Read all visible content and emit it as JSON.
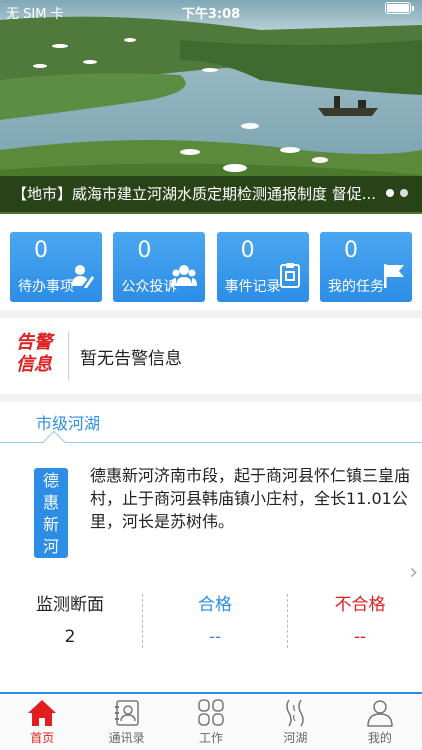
{
  "status_bar": {
    "carrier": "无 SIM 卡",
    "time": "下午3:08"
  },
  "banner": {
    "caption": "【地市】威海市建立河湖水质定期检测通报制度 督促..."
  },
  "cards": [
    {
      "count": "0",
      "label": "待办事项",
      "icon": "edit-user-icon"
    },
    {
      "count": "0",
      "label": "公众投诉",
      "icon": "group-icon"
    },
    {
      "count": "0",
      "label": "事件记录",
      "icon": "clipboard-icon"
    },
    {
      "count": "0",
      "label": "我的任务",
      "icon": "flag-icon"
    }
  ],
  "alert": {
    "logo_line1": "告警",
    "logo_line2": "信息",
    "text": "暂无告警信息"
  },
  "river": {
    "tab": "市级河湖",
    "name_chars": [
      "德",
      "惠",
      "新",
      "河"
    ],
    "description": "德惠新河济南市段，起于商河县怀仁镇三皇庙村，止于商河县韩庙镇小庄村，全长11.01公里，河长是苏树伟。",
    "stats": [
      {
        "label": "监测断面",
        "value": "2",
        "color": "#222222"
      },
      {
        "label": "合格",
        "value": "--",
        "color": "#2d8de6"
      },
      {
        "label": "不合格",
        "value": "--",
        "color": "#e02020"
      }
    ]
  },
  "tabbar": [
    {
      "label": "首页",
      "icon": "home-icon",
      "active": true
    },
    {
      "label": "通讯录",
      "icon": "contacts-icon",
      "active": false
    },
    {
      "label": "工作",
      "icon": "grid-icon",
      "active": false
    },
    {
      "label": "河湖",
      "icon": "river-icon",
      "active": false
    },
    {
      "label": "我的",
      "icon": "person-icon",
      "active": false
    }
  ],
  "colors": {
    "accent": "#2d8de6",
    "alert_red": "#e02020"
  }
}
